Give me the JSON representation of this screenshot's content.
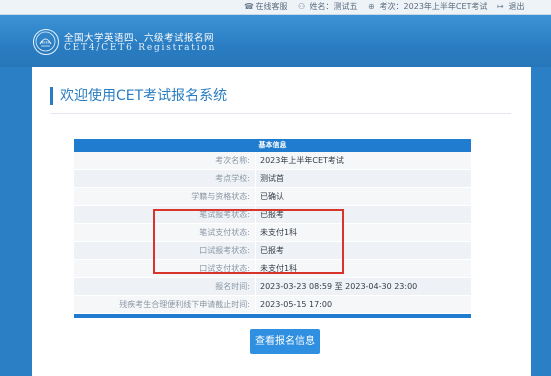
{
  "topbar": {
    "help": "在线客服",
    "name": "姓名：测试五",
    "exam": "考次：2023年上半年CET考试",
    "logout": "退出",
    "icons": [
      "headset-icon",
      "user-icon",
      "globe-icon",
      "logout-icon"
    ]
  },
  "header": {
    "brand_cn": "全国大学英语四、六级考试报名网",
    "brand_en": "CET4/CET6  Registration",
    "logo_text": "NEEA"
  },
  "main": {
    "title": "欢迎使用CET考试报名系统",
    "table_heading": "基本信息",
    "rows": [
      {
        "label": "考次名称:",
        "value": "2023年上半年CET考试"
      },
      {
        "label": "考点学校:",
        "value": "测试首"
      },
      {
        "label": "学籍与资格状态:",
        "value": "已确认"
      },
      {
        "label": "笔试报考状态:",
        "value": "已报考"
      },
      {
        "label": "笔试支付状态:",
        "value": "未支付1科"
      },
      {
        "label": "口试报考状态:",
        "value": "已报考"
      },
      {
        "label": "口试支付状态:",
        "value": "未支付1科"
      },
      {
        "label": "报名时间:",
        "value": "2023-03-23 08:59 至 2023-04-30 23:00"
      },
      {
        "label": "残疾考生合理便利线下申请截止时间:",
        "value": "2023-05-15 17:00"
      }
    ],
    "button": "查看报名信息"
  },
  "colors": {
    "brand_blue": "#2a7dc2",
    "table_header": "#1f7ccf",
    "button": "#2f8fe0",
    "highlight": "#d9342c"
  }
}
